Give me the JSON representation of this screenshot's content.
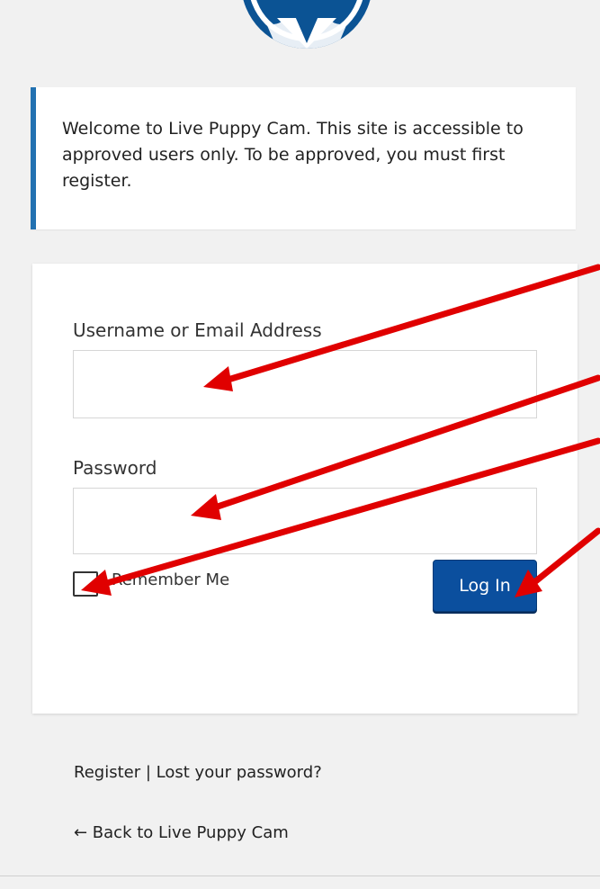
{
  "notice": {
    "text": "Welcome to Live Puppy Cam. This site is accessible to approved users only. To be approved, you must first register."
  },
  "login": {
    "username_label": "Username or Email Address",
    "username_value": "",
    "password_label": "Password",
    "password_value": "",
    "remember_label": "Remember Me",
    "remember_checked": false,
    "submit_label": "Log In"
  },
  "links": {
    "register": "Register",
    "separator": "|",
    "lost_password": "Lost your password?",
    "back": "← Back to Live Puppy Cam"
  },
  "colors": {
    "background": "#f1f1f1",
    "notice_accent": "#2271b1",
    "button": "#0b4f9e",
    "annotation_arrow": "#e00000",
    "logo": "#0b5394"
  },
  "icons": {
    "logo": "wordpress-logo-icon",
    "annotations": "red-arrow-icon"
  }
}
